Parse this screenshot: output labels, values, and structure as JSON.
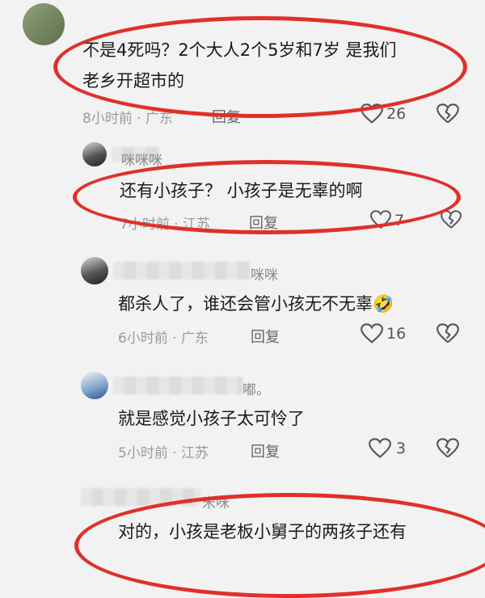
{
  "comments": [
    {
      "username": "",
      "text_line1": "不是4死吗？2个大人2个5岁和7岁 是我们",
      "text_line2": "老乡开超市的",
      "meta": "8小时前 · 广东",
      "reply": "回复",
      "likes": "26"
    },
    {
      "username": "咪咪咪",
      "text_line1": "还有小孩子？   小孩子是无辜的啊",
      "meta": "7小时前 · 江苏",
      "reply": "回复",
      "likes": "7"
    },
    {
      "username": "咪咪",
      "text_line1": "都杀人了，谁还会管小孩无不无辜",
      "emoji": "🤣",
      "meta": "6小时前 · 广东",
      "reply": "回复",
      "likes": "16"
    },
    {
      "username": "嘟。",
      "text_line1": "就是感觉小孩子太可怜了",
      "meta": "5小时前 · 江苏",
      "reply": "回复",
      "likes": "3"
    },
    {
      "username": "米咪",
      "text_line1": "对的，小孩是老板小舅子的两孩子还有"
    }
  ],
  "icons": {
    "like": "heart-outline-icon",
    "dislike": "broken-heart-icon"
  },
  "colors": {
    "highlight": "#e0302a",
    "background": "#f2f2f2"
  }
}
